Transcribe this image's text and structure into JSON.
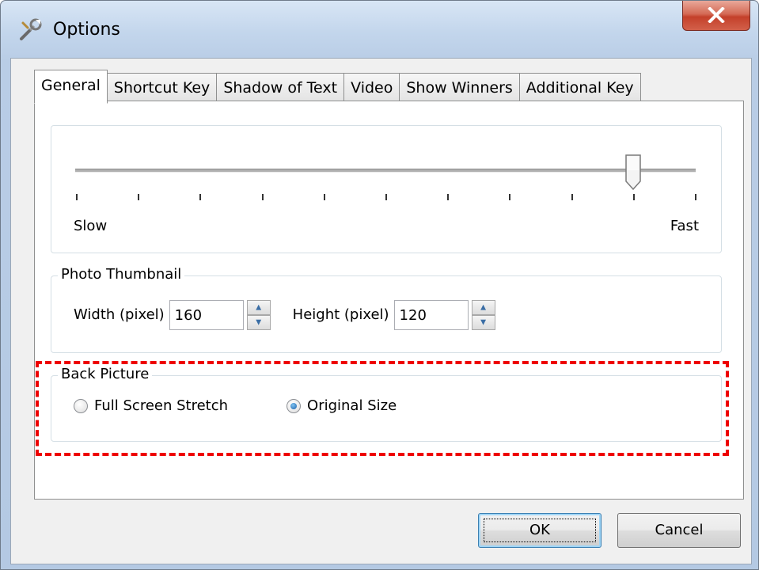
{
  "window": {
    "title": "Options",
    "icon": "wrench-icon",
    "close_icon": "close-icon"
  },
  "tabs": [
    {
      "label": "General",
      "active": true
    },
    {
      "label": "Shortcut Key",
      "active": false
    },
    {
      "label": "Shadow of Text",
      "active": false
    },
    {
      "label": "Video",
      "active": false
    },
    {
      "label": "Show Winners",
      "active": false
    },
    {
      "label": "Additional Key",
      "active": false
    }
  ],
  "speed_slider": {
    "min_label": "Slow",
    "max_label": "Fast",
    "tick_count": 11,
    "value_fraction": 0.9
  },
  "photo_thumbnail": {
    "title": "Photo Thumbnail",
    "width_label": "Width (pixel)",
    "width_value": "160",
    "height_label": "Height (pixel)",
    "height_value": "120"
  },
  "back_picture": {
    "title": "Back Picture",
    "options": [
      {
        "label": "Full Screen Stretch",
        "checked": false
      },
      {
        "label": "Original Size",
        "checked": true
      }
    ]
  },
  "buttons": {
    "ok_label": "OK",
    "cancel_label": "Cancel"
  },
  "colors": {
    "highlight": "#ee0000",
    "title_bar": "#c3d6ec",
    "close_button": "#c4402a"
  }
}
